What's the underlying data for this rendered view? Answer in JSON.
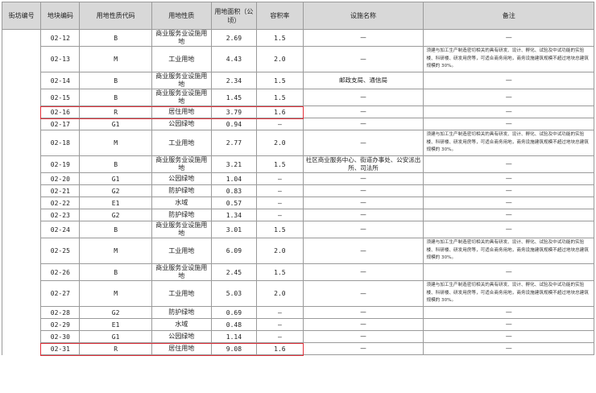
{
  "headers": {
    "block": "街坊编号",
    "plot": "地块编码",
    "code": "用地性质代码",
    "nature": "用地性质",
    "area": "用地面积（公顷）",
    "far": "容积率",
    "facility": "设施名称",
    "note": "备注"
  },
  "block_id": "",
  "industrial_note": "须建与加工生产制造密切相关的具有研发、设计、孵化、试验及中试功能的实验楼、科研楼、研发用房等，可适合商务用地，商务设施建筑规模不超过地块总建筑规模的 30%。",
  "rows": [
    {
      "plot": "02-12",
      "code": "B",
      "nature": "商业服务业设施用地",
      "area": "2.69",
      "far": "1.5",
      "facility": "—",
      "note": "—"
    },
    {
      "plot": "02-13",
      "code": "M",
      "nature": "工业用地",
      "area": "4.43",
      "far": "2.0",
      "facility": "—",
      "note": "须建与加工生产制造密切相关的具有研发、设计、孵化、试验及中试功能的实验楼、科研楼、研发用房等，可适合商务用地，商务设施建筑规模不超过地块总建筑规模的 30%。"
    },
    {
      "plot": "02-14",
      "code": "B",
      "nature": "商业服务业设施用地",
      "area": "2.34",
      "far": "1.5",
      "facility": "邮政支局、通信局",
      "note": "—"
    },
    {
      "plot": "02-15",
      "code": "B",
      "nature": "商业服务业设施用地",
      "area": "1.45",
      "far": "1.5",
      "facility": "—",
      "note": "—"
    },
    {
      "plot": "02-16",
      "code": "R",
      "nature": "居住用地",
      "area": "3.79",
      "far": "1.6",
      "facility": "—",
      "note": "—",
      "highlighted": true
    },
    {
      "plot": "02-17",
      "code": "G1",
      "nature": "公园绿地",
      "area": "0.94",
      "far": "—",
      "facility": "—",
      "note": "—"
    },
    {
      "plot": "02-18",
      "code": "M",
      "nature": "工业用地",
      "area": "2.77",
      "far": "2.0",
      "facility": "—",
      "note": "须建与加工生产制造密切相关的具有研发、设计、孵化、试验及中试功能的实验楼、科研楼、研发用房等，可适合商务用地，商务设施建筑规模不超过地块总建筑规模的 30%。"
    },
    {
      "plot": "02-19",
      "code": "B",
      "nature": "商业服务业设施用地",
      "area": "3.21",
      "far": "1.5",
      "facility": "社区商业服务中心、街道办事处、公安派出所、司法所",
      "note": "—"
    },
    {
      "plot": "02-20",
      "code": "G1",
      "nature": "公园绿地",
      "area": "1.04",
      "far": "—",
      "facility": "—",
      "note": "—"
    },
    {
      "plot": "02-21",
      "code": "G2",
      "nature": "防护绿地",
      "area": "0.83",
      "far": "—",
      "facility": "—",
      "note": "—"
    },
    {
      "plot": "02-22",
      "code": "E1",
      "nature": "水域",
      "area": "0.57",
      "far": "—",
      "facility": "—",
      "note": "—"
    },
    {
      "plot": "02-23",
      "code": "G2",
      "nature": "防护绿地",
      "area": "1.34",
      "far": "—",
      "facility": "—",
      "note": "—"
    },
    {
      "plot": "02-24",
      "code": "B",
      "nature": "商业服务业设施用地",
      "area": "3.01",
      "far": "1.5",
      "facility": "—",
      "note": "—"
    },
    {
      "plot": "02-25",
      "code": "M",
      "nature": "工业用地",
      "area": "6.09",
      "far": "2.0",
      "facility": "—",
      "note": "须建与加工生产制造密切相关的具有研发、设计、孵化、试验及中试功能的实验楼、科研楼、研发用房等，可适合商务用地，商务设施建筑规模不超过地块总建筑规模的 30%。"
    },
    {
      "plot": "02-26",
      "code": "B",
      "nature": "商业服务业设施用地",
      "area": "2.45",
      "far": "1.5",
      "facility": "—",
      "note": "—"
    },
    {
      "plot": "02-27",
      "code": "M",
      "nature": "工业用地",
      "area": "5.03",
      "far": "2.0",
      "facility": "—",
      "note": "须建与加工生产制造密切相关的具有研发、设计、孵化、试验及中试功能的实验楼、科研楼、研发用房等，可适合商务用地，商务设施建筑规模不超过地块总建筑规模的 30%。"
    },
    {
      "plot": "02-28",
      "code": "G2",
      "nature": "防护绿地",
      "area": "0.69",
      "far": "—",
      "facility": "—",
      "note": "—"
    },
    {
      "plot": "02-29",
      "code": "E1",
      "nature": "水域",
      "area": "0.48",
      "far": "—",
      "facility": "—",
      "note": "—"
    },
    {
      "plot": "02-30",
      "code": "G1",
      "nature": "公园绿地",
      "area": "1.14",
      "far": "—",
      "facility": "—",
      "note": "—"
    },
    {
      "plot": "02-31",
      "code": "R",
      "nature": "居住用地",
      "area": "9.08",
      "far": "1.6",
      "facility": "—",
      "note": "—",
      "highlighted": true
    }
  ],
  "colors": {
    "highlight": "#e0303a",
    "header_bg": "#d8d8d8",
    "border": "#9a9a9a"
  }
}
